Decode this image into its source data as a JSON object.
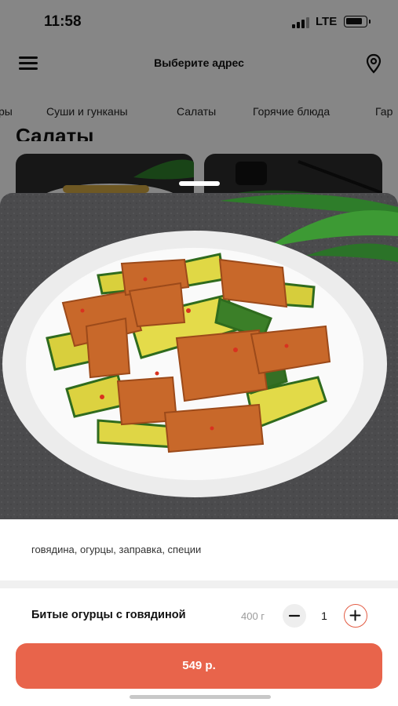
{
  "status_bar": {
    "time": "11:58",
    "network": "LTE"
  },
  "header": {
    "title": "Выберите адрес",
    "menu_icon": "menu-icon",
    "location_icon": "location-pin-icon"
  },
  "category_tabs": [
    {
      "label": "ры"
    },
    {
      "label": "Суши и гунканы"
    },
    {
      "label": "Салаты"
    },
    {
      "label": "Горячие блюда"
    },
    {
      "label": "Гар"
    }
  ],
  "section_title": "Салаты",
  "product": {
    "ingredients": "говядина, огурцы, заправка, специи",
    "name": "Битые огурцы с говядиной",
    "weight": "400 г",
    "quantity": "1",
    "price_button": "549 р."
  },
  "colors": {
    "accent": "#e8644b",
    "plus_border": "#e35d45",
    "sheet_bg": "#ffffff",
    "divider": "#f0f0f0"
  }
}
